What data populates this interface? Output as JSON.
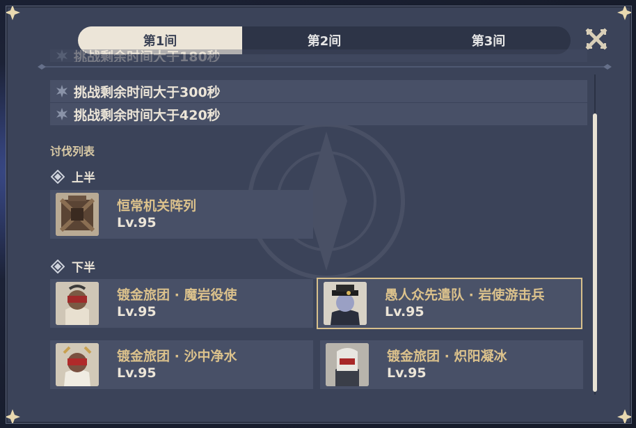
{
  "tabs": [
    {
      "label": "第1间",
      "active": true
    },
    {
      "label": "第2间",
      "active": false
    },
    {
      "label": "第3间",
      "active": false
    }
  ],
  "conditions": [
    {
      "text": "挑战剩余时间大于180秒"
    },
    {
      "text": "挑战剩余时间大于300秒"
    },
    {
      "text": "挑战剩余时间大于420秒"
    }
  ],
  "enemy_list": {
    "title": "讨伐列表",
    "first_half": {
      "label": "上半",
      "enemies": [
        {
          "name": "恒常机关阵列",
          "level": "Lv.95",
          "icon": "ruin-machine-portrait"
        }
      ]
    },
    "second_half": {
      "label": "下半",
      "enemies": [
        {
          "name": "镀金旅团 · 魔岩役使",
          "level": "Lv.95",
          "icon": "gilded-brigade-portrait"
        },
        {
          "name": "愚人众先遣队 · 岩使游击兵",
          "level": "Lv.95",
          "icon": "fatui-skirmisher-portrait",
          "selected": true
        },
        {
          "name": "镀金旅团 · 沙中净水",
          "level": "Lv.95",
          "icon": "gilded-brigade-portrait"
        },
        {
          "name": "镀金旅团 · 炽阳凝冰",
          "level": "Lv.95",
          "icon": "gilded-brigade-portrait"
        }
      ]
    }
  },
  "colors": {
    "panel": "#3b4359",
    "row": "#485067",
    "accent_gold": "#dcc28c",
    "text_light": "#ece5d8"
  }
}
